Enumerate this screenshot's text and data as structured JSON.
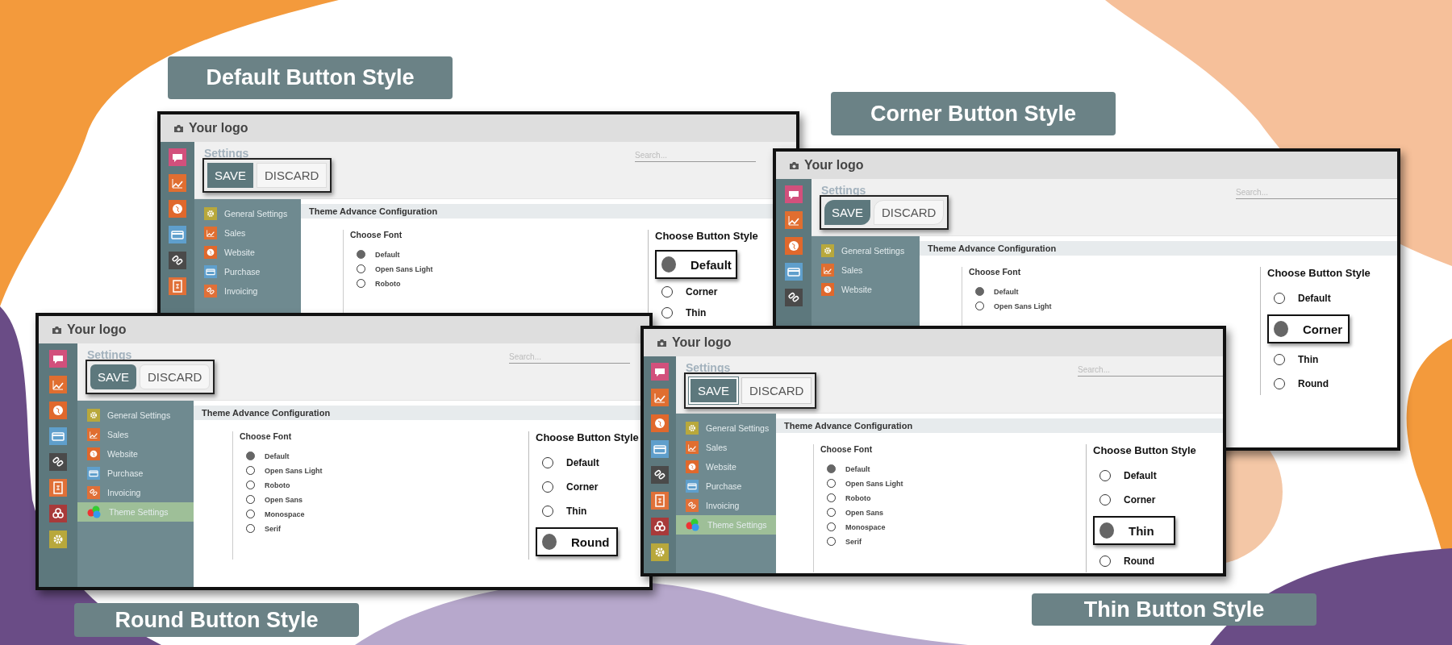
{
  "panels": [
    {
      "kind": "default",
      "caption": "Default Button Style",
      "window": {
        "logo": "Your logo",
        "heading": "Settings",
        "search": {
          "placeholder": "Search..."
        },
        "buttons": [
          "SAVE",
          "DISCARD"
        ],
        "menu": [
          {
            "label": "General Settings",
            "selected": false
          },
          {
            "label": "Sales",
            "selected": false
          },
          {
            "label": "Website",
            "selected": false
          },
          {
            "label": "Purchase",
            "selected": false
          },
          {
            "label": "Invoicing",
            "selected": false
          }
        ],
        "section_title": "Theme Advance Configuration",
        "fonts": {
          "title": "Choose Font",
          "options": [
            {
              "label": "Default",
              "selected": true
            },
            {
              "label": "Open Sans Light",
              "selected": false
            },
            {
              "label": "Roboto",
              "selected": false
            }
          ]
        },
        "button_styles": {
          "title": "Choose Button Style",
          "options": [
            {
              "label": "Default",
              "selected": true
            },
            {
              "label": "Corner",
              "selected": false
            },
            {
              "label": "Thin",
              "selected": false
            }
          ]
        }
      }
    },
    {
      "kind": "corner",
      "caption": "Corner Button Style",
      "window": {
        "logo": "Your logo",
        "heading": "Settings",
        "search": {
          "placeholder": "Search..."
        },
        "buttons": [
          "SAVE",
          "DISCARD"
        ],
        "menu": [
          {
            "label": "General Settings",
            "selected": false
          },
          {
            "label": "Sales",
            "selected": false
          },
          {
            "label": "Website",
            "selected": false
          }
        ],
        "section_title": "Theme Advance Configuration",
        "fonts": {
          "title": "Choose Font",
          "options": [
            {
              "label": "Default",
              "selected": true
            },
            {
              "label": "Open Sans Light",
              "selected": false
            }
          ]
        },
        "button_styles": {
          "title": "Choose Button Style",
          "options": [
            {
              "label": "Default",
              "selected": false
            },
            {
              "label": "Corner",
              "selected": true
            },
            {
              "label": "Thin",
              "selected": false
            },
            {
              "label": "Round",
              "selected": false
            }
          ]
        }
      }
    },
    {
      "kind": "round",
      "caption": "Round Button Style",
      "window": {
        "logo": "Your logo",
        "heading": "Settings",
        "search": {
          "placeholder": "Search..."
        },
        "buttons": [
          "SAVE",
          "DISCARD"
        ],
        "menu": [
          {
            "label": "General Settings",
            "selected": false
          },
          {
            "label": "Sales",
            "selected": false
          },
          {
            "label": "Website",
            "selected": false
          },
          {
            "label": "Purchase",
            "selected": false
          },
          {
            "label": "Invoicing",
            "selected": false
          },
          {
            "label": "Theme Settings",
            "selected": true
          }
        ],
        "section_title": "Theme Advance Configuration",
        "fonts": {
          "title": "Choose Font",
          "options": [
            {
              "label": "Default",
              "selected": true
            },
            {
              "label": "Open Sans Light",
              "selected": false
            },
            {
              "label": "Roboto",
              "selected": false
            },
            {
              "label": "Open Sans",
              "selected": false
            },
            {
              "label": "Monospace",
              "selected": false
            },
            {
              "label": "Serif",
              "selected": false
            }
          ]
        },
        "button_styles": {
          "title": "Choose Button Style",
          "options": [
            {
              "label": "Default",
              "selected": false
            },
            {
              "label": "Corner",
              "selected": false
            },
            {
              "label": "Thin",
              "selected": false
            },
            {
              "label": "Round",
              "selected": true
            }
          ]
        }
      }
    },
    {
      "kind": "thin",
      "caption": "Thin Button Style",
      "window": {
        "logo": "Your logo",
        "heading": "Settings",
        "search": {
          "placeholder": "Search..."
        },
        "buttons": [
          "SAVE",
          "DISCARD"
        ],
        "menu": [
          {
            "label": "General Settings",
            "selected": false
          },
          {
            "label": "Sales",
            "selected": false
          },
          {
            "label": "Website",
            "selected": false
          },
          {
            "label": "Purchase",
            "selected": false
          },
          {
            "label": "Invoicing",
            "selected": false
          },
          {
            "label": "Theme Settings",
            "selected": true
          }
        ],
        "section_title": "Theme Advance Configuration",
        "fonts": {
          "title": "Choose Font",
          "options": [
            {
              "label": "Default",
              "selected": true
            },
            {
              "label": "Open Sans Light",
              "selected": false
            },
            {
              "label": "Roboto",
              "selected": false
            },
            {
              "label": "Open Sans",
              "selected": false
            },
            {
              "label": "Monospace",
              "selected": false
            },
            {
              "label": "Serif",
              "selected": false
            }
          ]
        },
        "button_styles": {
          "title": "Choose Button Style",
          "options": [
            {
              "label": "Default",
              "selected": false
            },
            {
              "label": "Corner",
              "selected": false
            },
            {
              "label": "Thin",
              "selected": true
            },
            {
              "label": "Round",
              "selected": false
            }
          ]
        }
      }
    }
  ]
}
